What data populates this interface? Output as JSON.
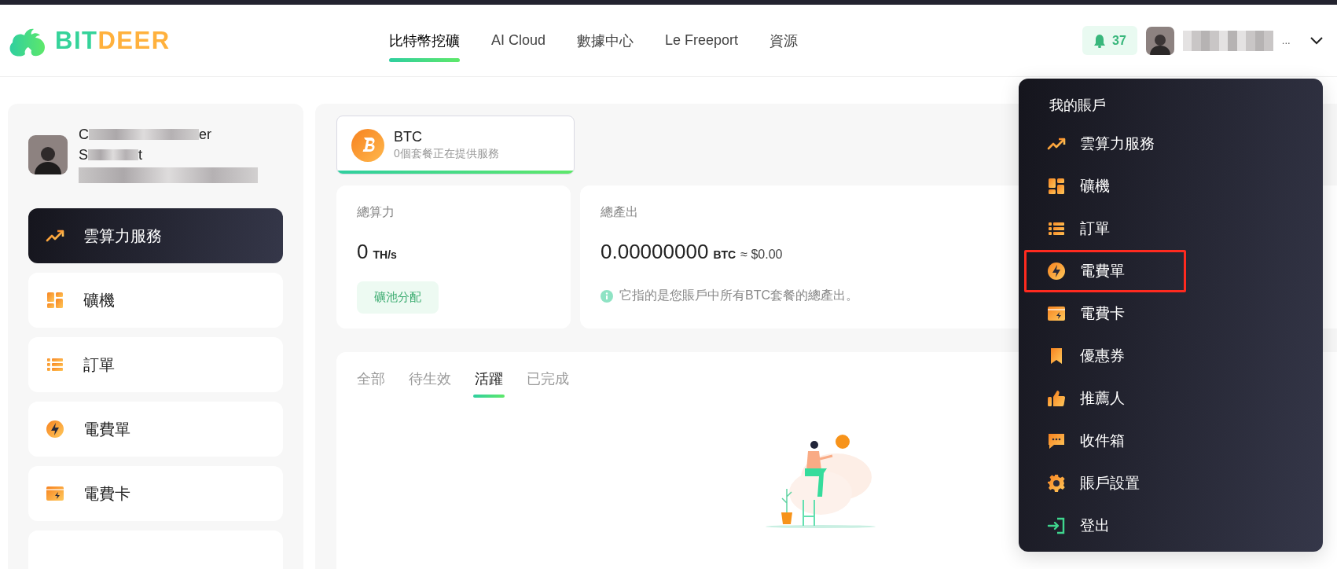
{
  "header": {
    "logo": {
      "part_1": "BIT",
      "part_2": "DEER"
    },
    "nav": [
      {
        "label": "比特幣挖礦",
        "selected": true
      },
      {
        "label": "AI Cloud",
        "selected": false
      },
      {
        "label": "數據中心",
        "selected": false
      },
      {
        "label": "Le Freeport",
        "selected": false
      },
      {
        "label": "資源",
        "selected": false
      }
    ],
    "notifications": {
      "count": "37"
    },
    "user": {
      "name_tail": "..."
    }
  },
  "sidebar": {
    "profile": {
      "name_line_1": [
        "C",
        "er"
      ],
      "name_line_2": [
        "S",
        "t"
      ]
    },
    "items": [
      {
        "label": "雲算力服務",
        "kind": "trend",
        "selected": true
      },
      {
        "label": "礦機",
        "kind": "grid",
        "selected": false
      },
      {
        "label": "訂單",
        "kind": "list",
        "selected": false
      },
      {
        "label": "電費單",
        "kind": "bolt",
        "selected": false
      },
      {
        "label": "電費卡",
        "kind": "card",
        "selected": false
      }
    ]
  },
  "main": {
    "coin_card": {
      "symbol": "BTC",
      "subtitle": "0個套餐正在提供服務",
      "selected": true
    },
    "hashrate": {
      "label": "總算力",
      "value": "0",
      "unit": "TH/s",
      "button": "礦池分配"
    },
    "output": {
      "label": "總產出",
      "value": "0.00000000",
      "unit": "BTC",
      "fiat": "≈ $0.00",
      "note": "它指的是您賬戶中所有BTC套餐的總產出。"
    },
    "tabs": [
      {
        "label": "全部",
        "selected": false
      },
      {
        "label": "待生效",
        "selected": false
      },
      {
        "label": "活躍",
        "selected": true
      },
      {
        "label": "已完成",
        "selected": false
      }
    ]
  },
  "account_menu": {
    "title": "我的賬戶",
    "items": [
      {
        "label": "雲算力服務",
        "kind": "trend",
        "highlighted": false
      },
      {
        "label": "礦機",
        "kind": "grid",
        "highlighted": false
      },
      {
        "label": "訂單",
        "kind": "list",
        "highlighted": false
      },
      {
        "label": "電費單",
        "kind": "bolt",
        "highlighted": true
      },
      {
        "label": "電費卡",
        "kind": "card",
        "highlighted": false
      },
      {
        "label": "優惠券",
        "kind": "bookmark",
        "highlighted": false
      },
      {
        "label": "推薦人",
        "kind": "thumb",
        "highlighted": false
      },
      {
        "label": "收件箱",
        "kind": "chat",
        "highlighted": false
      },
      {
        "label": "賬戶設置",
        "kind": "gear",
        "highlighted": false
      },
      {
        "label": "登出",
        "kind": "logout",
        "highlighted": false
      }
    ]
  }
}
